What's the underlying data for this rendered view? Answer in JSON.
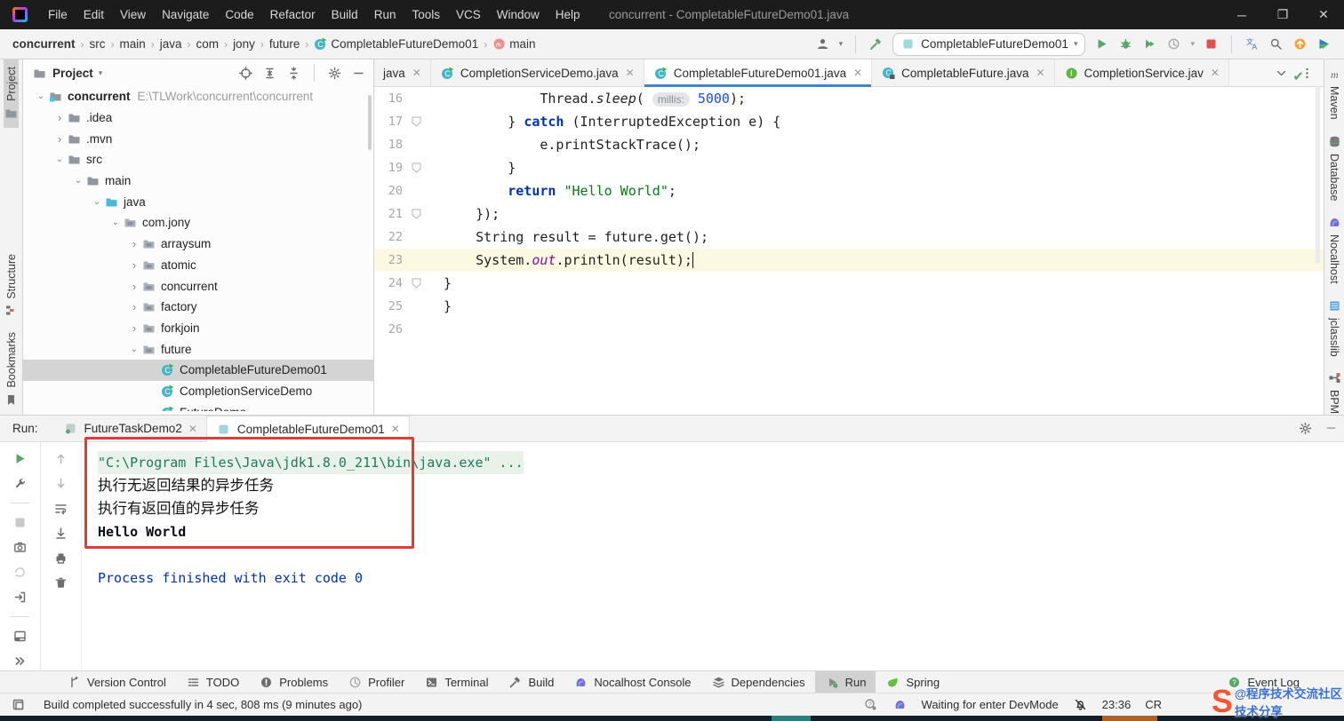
{
  "titlebar": {
    "menus": [
      "File",
      "Edit",
      "View",
      "Navigate",
      "Code",
      "Refactor",
      "Build",
      "Run",
      "Tools",
      "VCS",
      "Window",
      "Help"
    ],
    "title": "concurrent - CompletableFutureDemo01.java",
    "controls": {
      "minimize": "─",
      "maximize": "❐",
      "close": "✕"
    }
  },
  "navbar": {
    "breadcrumbs": [
      {
        "label": "concurrent",
        "bold": true
      },
      {
        "label": "src"
      },
      {
        "label": "main"
      },
      {
        "label": "java"
      },
      {
        "label": "com"
      },
      {
        "label": "jony"
      },
      {
        "label": "future"
      },
      {
        "label": "CompletableFutureDemo01",
        "icon": "class-run"
      },
      {
        "label": "main",
        "icon": "method"
      }
    ],
    "run_config": "CompletableFutureDemo01",
    "right_icons": [
      "user-icon",
      "hammer-icon",
      "run-icon",
      "debug-icon",
      "coverage-icon",
      "profiler-icon",
      "stop-icon",
      "translate-icon",
      "search-icon",
      "update-icon",
      "plugin-logo-icon"
    ]
  },
  "left_stripe": {
    "top": [
      {
        "label": "Project",
        "icon": "folder",
        "selected": true
      }
    ],
    "bottom": [
      {
        "label": "Structure",
        "icon": "structure"
      },
      {
        "label": "Bookmarks",
        "icon": "bookmark"
      }
    ]
  },
  "right_stripe": {
    "top": [
      {
        "label": "Maven",
        "icon": "maven"
      },
      {
        "label": "Database",
        "icon": "database"
      },
      {
        "label": "Nocalhost",
        "icon": "nocalhost"
      },
      {
        "label": "jclasslib",
        "icon": "jclasslib"
      }
    ],
    "bottom": [
      {
        "label": "BPMN-Activiti-Diagram",
        "icon": "bpmn"
      }
    ]
  },
  "project_panel": {
    "title": "Project",
    "header_icons": [
      "locate-icon",
      "expand-all-icon",
      "collapse-all-icon",
      "settings-icon",
      "hide-icon"
    ],
    "tree": [
      {
        "label": "concurrent",
        "path": "E:\\TLWork\\concurrent\\concurrent",
        "depth": 0,
        "chevron": "open",
        "icon": "project",
        "bold": true
      },
      {
        "label": ".idea",
        "depth": 1,
        "chevron": "closed",
        "icon": "folder"
      },
      {
        "label": ".mvn",
        "depth": 1,
        "chevron": "closed",
        "icon": "folder"
      },
      {
        "label": "src",
        "depth": 1,
        "chevron": "open",
        "icon": "folder"
      },
      {
        "label": "main",
        "depth": 2,
        "chevron": "open",
        "icon": "folder"
      },
      {
        "label": "java",
        "depth": 3,
        "chevron": "open",
        "icon": "src-folder"
      },
      {
        "label": "com.jony",
        "depth": 4,
        "chevron": "open",
        "icon": "package"
      },
      {
        "label": "arraysum",
        "depth": 5,
        "chevron": "closed",
        "icon": "package"
      },
      {
        "label": "atomic",
        "depth": 5,
        "chevron": "closed",
        "icon": "package"
      },
      {
        "label": "concurrent",
        "depth": 5,
        "chevron": "closed",
        "icon": "package"
      },
      {
        "label": "factory",
        "depth": 5,
        "chevron": "closed",
        "icon": "package"
      },
      {
        "label": "forkjoin",
        "depth": 5,
        "chevron": "closed",
        "icon": "package"
      },
      {
        "label": "future",
        "depth": 5,
        "chevron": "open",
        "icon": "package"
      },
      {
        "label": "CompletableFutureDemo01",
        "depth": 6,
        "chevron": "none",
        "icon": "class-run",
        "selected": true
      },
      {
        "label": "CompletionServiceDemo",
        "depth": 6,
        "chevron": "none",
        "icon": "class-run"
      },
      {
        "label": "FutureDemo",
        "depth": 6,
        "chevron": "none",
        "icon": "class-run",
        "partial": true
      }
    ]
  },
  "editor": {
    "tabs": [
      {
        "label": "java",
        "icon": null,
        "active": false
      },
      {
        "label": "CompletionServiceDemo.java",
        "icon": "class-run",
        "active": false
      },
      {
        "label": "CompletableFutureDemo01.java",
        "icon": "class-run",
        "active": true
      },
      {
        "label": "CompletableFuture.java",
        "icon": "class-lock",
        "active": false
      },
      {
        "label": "CompletionService.jav",
        "icon": "interface",
        "active": false
      }
    ],
    "code_lines": [
      {
        "n": "16",
        "fold": false,
        "cur": false,
        "segs": [
          [
            "p",
            "            Thread."
          ],
          [
            "it",
            "sleep"
          ],
          [
            "p",
            "( "
          ],
          [
            "hint",
            "millis:"
          ],
          [
            "p",
            " "
          ],
          [
            "num",
            "5000"
          ],
          [
            "p",
            ");"
          ]
        ]
      },
      {
        "n": "17",
        "fold": true,
        "cur": false,
        "segs": [
          [
            "p",
            "        } "
          ],
          [
            "kw",
            "catch"
          ],
          [
            "p",
            " (InterruptedException e) {"
          ]
        ]
      },
      {
        "n": "18",
        "fold": false,
        "cur": false,
        "segs": [
          [
            "p",
            "            e.printStackTrace();"
          ]
        ]
      },
      {
        "n": "19",
        "fold": true,
        "cur": false,
        "segs": [
          [
            "p",
            "        }"
          ]
        ]
      },
      {
        "n": "20",
        "fold": false,
        "cur": false,
        "segs": [
          [
            "p",
            "        "
          ],
          [
            "kw",
            "return"
          ],
          [
            "p",
            " "
          ],
          [
            "str",
            "\"Hello World\""
          ],
          [
            "p",
            ";"
          ]
        ]
      },
      {
        "n": "21",
        "fold": true,
        "cur": false,
        "segs": [
          [
            "p",
            "    });"
          ]
        ]
      },
      {
        "n": "22",
        "fold": false,
        "cur": false,
        "segs": [
          [
            "p",
            "    String result = future.get();"
          ]
        ]
      },
      {
        "n": "23",
        "fold": false,
        "cur": true,
        "caret": true,
        "segs": [
          [
            "p",
            "    System."
          ],
          [
            "fld",
            "out"
          ],
          [
            "p",
            ".println(result);"
          ]
        ]
      },
      {
        "n": "24",
        "fold": true,
        "cur": false,
        "segs": [
          [
            "p",
            "}"
          ]
        ]
      },
      {
        "n": "25",
        "fold": false,
        "cur": false,
        "segs": [
          [
            "p",
            "}"
          ]
        ]
      },
      {
        "n": "26",
        "fold": false,
        "cur": false,
        "segs": []
      }
    ]
  },
  "run_panel": {
    "label": "Run:",
    "tabs": [
      {
        "label": "FutureTaskDemo2",
        "icon": "process-done",
        "selected": false
      },
      {
        "label": "CompletableFutureDemo01",
        "icon": "process-current",
        "selected": true
      }
    ],
    "header_icons": [
      "settings-icon",
      "hide-icon"
    ],
    "toolbar_col1": [
      "rerun-icon",
      "edit-config-icon",
      "sep",
      "stop-gray-icon",
      "thread-dump-icon",
      "restart-debug-icon",
      "exit-icon",
      "sep",
      "layout-icon",
      "more-icon"
    ],
    "toolbar_col2": [
      "up-icon",
      "down-icon",
      "soft-wrap-icon",
      "scroll-end-icon",
      "print-icon",
      "clear-icon"
    ],
    "console": [
      {
        "type": "cmd",
        "text": "\"C:\\Program Files\\Java\\jdk1.8.0_211\\bin\\java.exe\" ..."
      },
      {
        "type": "cn",
        "text": "执行无返回结果的异步任务"
      },
      {
        "type": "cn",
        "text": "执行有返回值的异步任务"
      },
      {
        "type": "out",
        "text": "Hello World"
      },
      {
        "type": "blank",
        "text": ""
      },
      {
        "type": "sys",
        "text": "Process finished with exit code 0"
      }
    ]
  },
  "bottom_bar": {
    "items": [
      {
        "label": "Version Control",
        "icon": "branch"
      },
      {
        "label": "TODO",
        "icon": "todo"
      },
      {
        "label": "Problems",
        "icon": "problems"
      },
      {
        "label": "Profiler",
        "icon": "profiler"
      },
      {
        "label": "Terminal",
        "icon": "terminal"
      },
      {
        "label": "Build",
        "icon": "build"
      },
      {
        "label": "Nocalhost Console",
        "icon": "nocalhost"
      },
      {
        "label": "Dependencies",
        "icon": "deps"
      },
      {
        "label": "Run",
        "icon": "run",
        "selected": true
      },
      {
        "label": "Spring",
        "icon": "spring"
      }
    ],
    "event_log": "Event Log"
  },
  "status_bar": {
    "message": "Build completed successfully in 4 sec, 808 ms (9 minutes ago)",
    "devmode": "Waiting for enter DevMode",
    "time": "23:36",
    "encoding": "CR"
  },
  "watermark": {
    "logo": "S",
    "line1": "@程序技术交流社区",
    "line2": "技术分享"
  }
}
